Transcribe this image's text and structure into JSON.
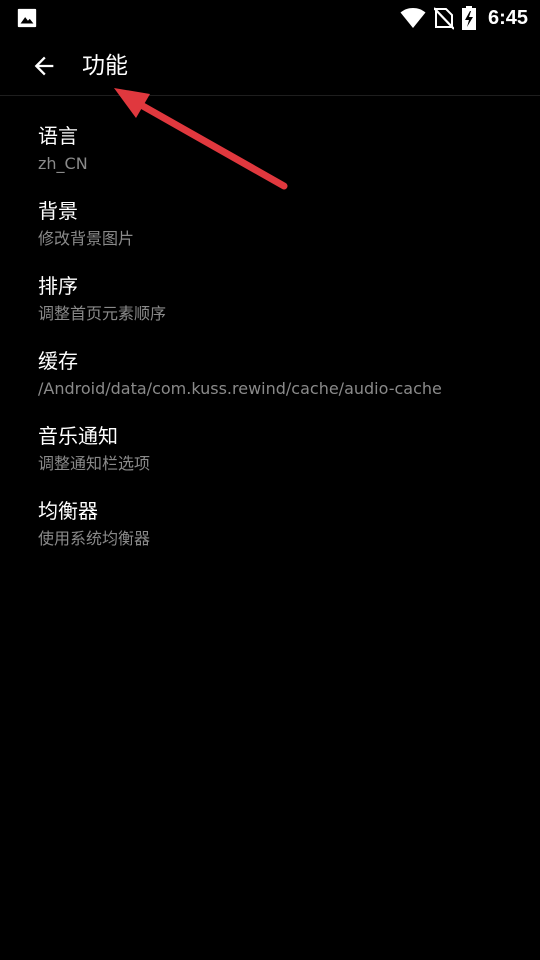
{
  "status_bar": {
    "time": "6:45",
    "icons": [
      "image-icon",
      "wifi-icon",
      "no-sim-icon",
      "battery-charging-icon"
    ]
  },
  "app_bar": {
    "back_icon": "arrow-back-icon",
    "title": "功能"
  },
  "settings": [
    {
      "title": "语言",
      "summary": "zh_CN"
    },
    {
      "title": "背景",
      "summary": "修改背景图片"
    },
    {
      "title": "排序",
      "summary": "调整首页元素顺序"
    },
    {
      "title": "缓存",
      "summary": "/Android/data/com.kuss.rewind/cache/audio-cache"
    },
    {
      "title": "音乐通知",
      "summary": "调整通知栏选项"
    },
    {
      "title": "均衡器",
      "summary": "使用系统均衡器"
    }
  ],
  "colors": {
    "background": "#000000",
    "text_primary": "#ffffff",
    "text_secondary": "#8a8a8a",
    "annotation_arrow": "#e0383e"
  }
}
